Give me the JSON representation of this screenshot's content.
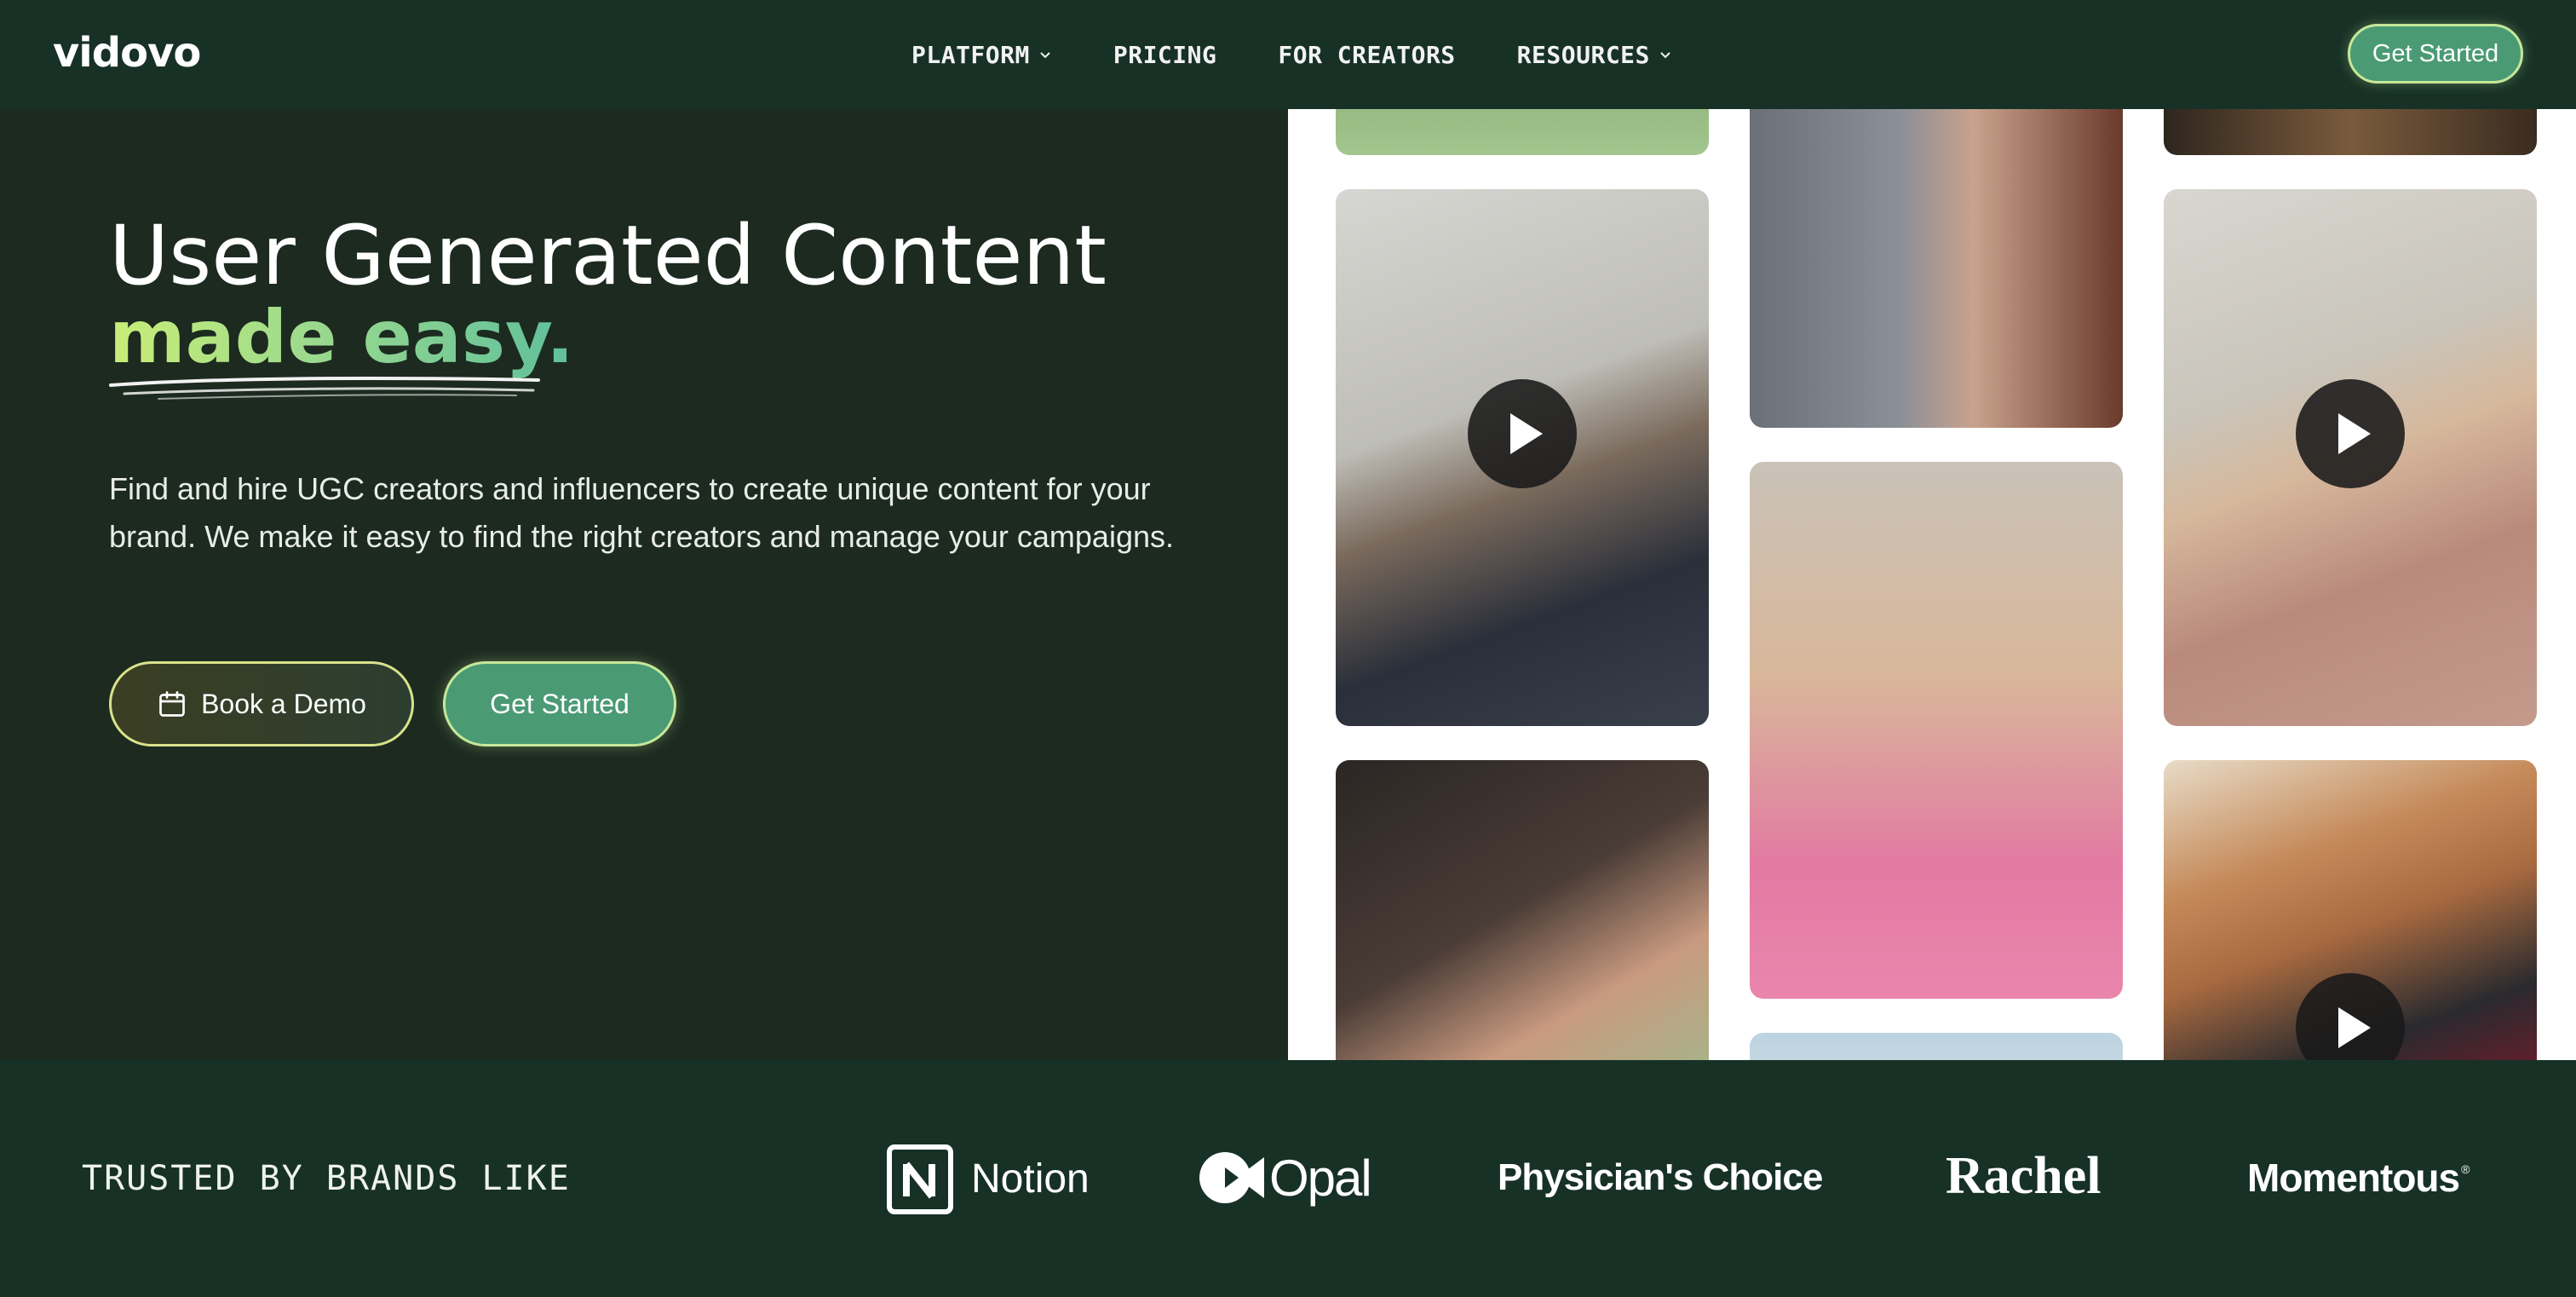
{
  "nav": {
    "logo": "vidovo",
    "links": [
      {
        "label": "PLATFORM",
        "dropdown": true
      },
      {
        "label": "PRICING",
        "dropdown": false
      },
      {
        "label": "FOR CREATORS",
        "dropdown": false
      },
      {
        "label": "RESOURCES",
        "dropdown": true
      }
    ],
    "cta": "Get Started"
  },
  "hero": {
    "title_line1": "User Generated Content",
    "title_line2": "made easy.",
    "lead": "Find and hire UGC creators and influencers to create unique content for your brand. We make it easy to find the right creators and manage your campaigns.",
    "demo_button": "Book a Demo",
    "start_button": "Get Started"
  },
  "gallery": {
    "tiles": [
      {
        "icon": "video-thumbnail",
        "has_play": false
      },
      {
        "icon": "video-thumbnail",
        "has_play": true
      },
      {
        "icon": "video-thumbnail",
        "has_play": false
      },
      {
        "icon": "video-thumbnail",
        "has_play": false
      },
      {
        "icon": "video-thumbnail",
        "has_play": false
      },
      {
        "icon": "video-thumbnail",
        "has_play": false
      },
      {
        "icon": "video-thumbnail",
        "has_play": false
      },
      {
        "icon": "video-thumbnail",
        "has_play": true
      },
      {
        "icon": "video-thumbnail",
        "has_play": true
      }
    ]
  },
  "brands": {
    "label": "TRUSTED BY BRANDS LIKE",
    "logos": [
      "Notion",
      "Opal",
      "Physician's Choice",
      "Rachel",
      "Momentous"
    ]
  },
  "colors": {
    "nav_bg": "#173126",
    "hero_bg": "#1c2a20",
    "accent_green": "#4a9a74",
    "accent_lime": "#c5e89a"
  }
}
